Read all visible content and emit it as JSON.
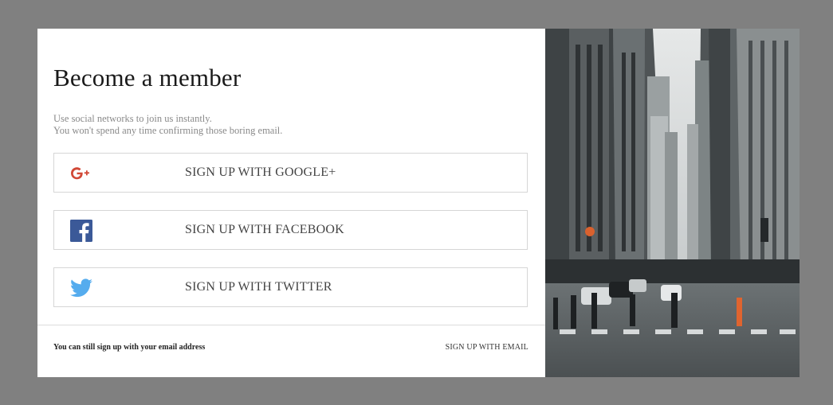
{
  "modal": {
    "title": "Become a member",
    "subtitle_line1": "Use social networks to join us instantly.",
    "subtitle_line2": "You won't spend any time confirming those boring email."
  },
  "social_buttons": [
    {
      "label": "SIGN UP WITH GOOGLE+",
      "icon": "google-plus-icon",
      "color": "#d14836"
    },
    {
      "label": "SIGN UP WITH FACEBOOK",
      "icon": "facebook-icon",
      "color": "#3b5998"
    },
    {
      "label": "SIGN UP WITH TWITTER",
      "icon": "twitter-icon",
      "color": "#55acee"
    }
  ],
  "footer": {
    "note": "You can still sign up with your email address",
    "email_link": "SIGN UP WITH EMAIL"
  },
  "side_image": {
    "subject": "city-street-photo"
  },
  "colors": {
    "overlay": "#808080",
    "panel": "#ffffff",
    "border": "#d6d6d6"
  }
}
